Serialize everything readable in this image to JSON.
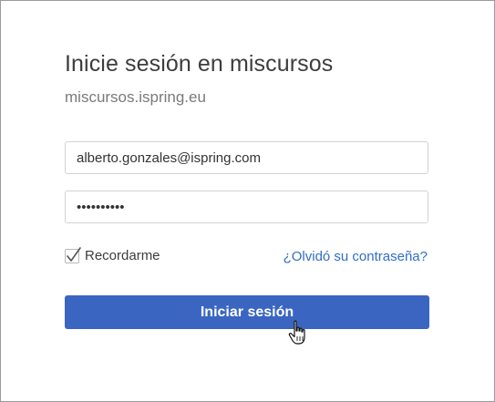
{
  "header": {
    "title": "Inicie sesión en miscursos",
    "subtitle": "miscursos.ispring.eu"
  },
  "form": {
    "email_value": "alberto.gonzales@ispring.com",
    "password_masked": "••••••••••",
    "remember_label": "Recordarme",
    "remember_checked": true,
    "forgot_link": "¿Olvidó su contraseña?",
    "submit_label": "Iniciar sesión"
  },
  "colors": {
    "primary_button": "#3a66c2",
    "link": "#2f6ec7"
  },
  "icons": {
    "checkmark": "check-icon",
    "cursor": "hand-pointer-icon"
  }
}
